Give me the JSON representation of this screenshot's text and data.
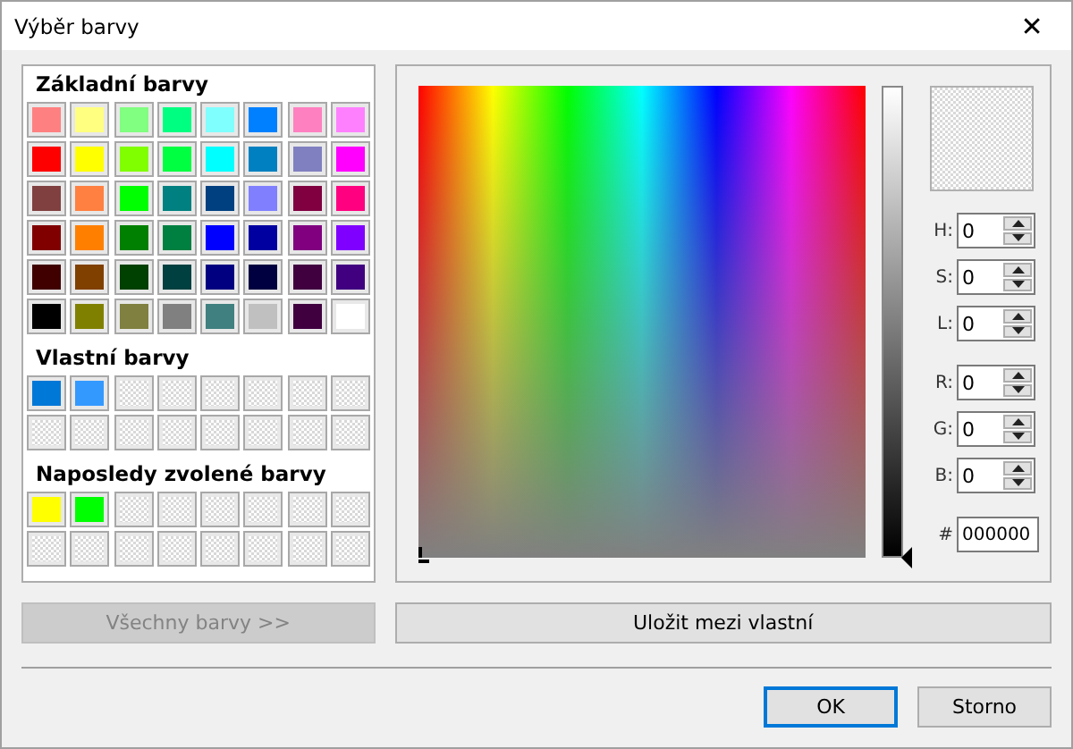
{
  "window": {
    "title": "Výběr barvy",
    "close": "✕"
  },
  "basic": {
    "heading": "Základní barvy",
    "swatches": [
      {
        "kind": "color",
        "color": "#ff8080"
      },
      {
        "kind": "color",
        "color": "#ffff80"
      },
      {
        "kind": "color",
        "color": "#80ff80"
      },
      {
        "kind": "color",
        "color": "#00ff80"
      },
      {
        "kind": "color",
        "color": "#80ffff"
      },
      {
        "kind": "color",
        "color": "#0080ff"
      },
      {
        "kind": "color",
        "color": "#ff80c0"
      },
      {
        "kind": "color",
        "color": "#ff80ff"
      },
      {
        "kind": "color",
        "color": "#ff0000"
      },
      {
        "kind": "color",
        "color": "#ffff00"
      },
      {
        "kind": "color",
        "color": "#80ff00"
      },
      {
        "kind": "color",
        "color": "#00ff40"
      },
      {
        "kind": "color",
        "color": "#00ffff"
      },
      {
        "kind": "color",
        "color": "#0080c0"
      },
      {
        "kind": "color",
        "color": "#8080c0"
      },
      {
        "kind": "color",
        "color": "#ff00ff"
      },
      {
        "kind": "color",
        "color": "#804040"
      },
      {
        "kind": "color",
        "color": "#ff8040"
      },
      {
        "kind": "color",
        "color": "#00ff00"
      },
      {
        "kind": "color",
        "color": "#008080"
      },
      {
        "kind": "color",
        "color": "#004080"
      },
      {
        "kind": "color",
        "color": "#8080ff"
      },
      {
        "kind": "color",
        "color": "#800040"
      },
      {
        "kind": "color",
        "color": "#ff0080"
      },
      {
        "kind": "color",
        "color": "#800000"
      },
      {
        "kind": "color",
        "color": "#ff8000"
      },
      {
        "kind": "color",
        "color": "#008000"
      },
      {
        "kind": "color",
        "color": "#008040"
      },
      {
        "kind": "color",
        "color": "#0000ff"
      },
      {
        "kind": "color",
        "color": "#0000a0"
      },
      {
        "kind": "color",
        "color": "#800080"
      },
      {
        "kind": "color",
        "color": "#8000ff"
      },
      {
        "kind": "color",
        "color": "#400000"
      },
      {
        "kind": "color",
        "color": "#804000"
      },
      {
        "kind": "color",
        "color": "#004000"
      },
      {
        "kind": "color",
        "color": "#004040"
      },
      {
        "kind": "color",
        "color": "#000080"
      },
      {
        "kind": "color",
        "color": "#000040"
      },
      {
        "kind": "color",
        "color": "#400040"
      },
      {
        "kind": "color",
        "color": "#400080"
      },
      {
        "kind": "color",
        "color": "#000000"
      },
      {
        "kind": "color",
        "color": "#808000"
      },
      {
        "kind": "color",
        "color": "#808040"
      },
      {
        "kind": "color",
        "color": "#808080"
      },
      {
        "kind": "color",
        "color": "#408080"
      },
      {
        "kind": "color",
        "color": "#c0c0c0"
      },
      {
        "kind": "color",
        "color": "#400040"
      },
      {
        "kind": "color",
        "color": "#ffffff"
      }
    ]
  },
  "custom": {
    "heading": "Vlastní barvy",
    "swatches": [
      {
        "kind": "color",
        "color": "#0078d7"
      },
      {
        "kind": "color",
        "color": "#3399ff"
      },
      {
        "kind": "empty"
      },
      {
        "kind": "empty"
      },
      {
        "kind": "empty"
      },
      {
        "kind": "empty"
      },
      {
        "kind": "empty"
      },
      {
        "kind": "empty"
      },
      {
        "kind": "empty"
      },
      {
        "kind": "empty"
      },
      {
        "kind": "empty"
      },
      {
        "kind": "empty"
      },
      {
        "kind": "empty"
      },
      {
        "kind": "empty"
      },
      {
        "kind": "empty"
      },
      {
        "kind": "empty"
      }
    ]
  },
  "recent": {
    "heading": "Naposledy zvolené barvy",
    "swatches": [
      {
        "kind": "color",
        "color": "#ffff00"
      },
      {
        "kind": "color",
        "color": "#00ff00"
      },
      {
        "kind": "empty"
      },
      {
        "kind": "empty"
      },
      {
        "kind": "empty"
      },
      {
        "kind": "empty"
      },
      {
        "kind": "empty"
      },
      {
        "kind": "empty"
      },
      {
        "kind": "empty"
      },
      {
        "kind": "empty"
      },
      {
        "kind": "empty"
      },
      {
        "kind": "empty"
      },
      {
        "kind": "empty"
      },
      {
        "kind": "empty"
      },
      {
        "kind": "empty"
      },
      {
        "kind": "empty"
      }
    ]
  },
  "luminance": {
    "level": 0
  },
  "fields": [
    {
      "label": "H:",
      "value": "0"
    },
    {
      "label": "S:",
      "value": "0"
    },
    {
      "label": "L:",
      "value": "0"
    },
    {
      "label": "R:",
      "value": "0"
    },
    {
      "label": "G:",
      "value": "0"
    },
    {
      "label": "B:",
      "value": "0"
    }
  ],
  "hex": {
    "label": "#",
    "value": "000000"
  },
  "all_colors_button": {
    "label": "Všechny barvy >>",
    "disabled": true
  },
  "save_button": {
    "label": "Uložit mezi vlastní"
  },
  "buttons": [
    {
      "label": "OK",
      "default": true
    },
    {
      "label": "Storno",
      "default": false
    }
  ]
}
